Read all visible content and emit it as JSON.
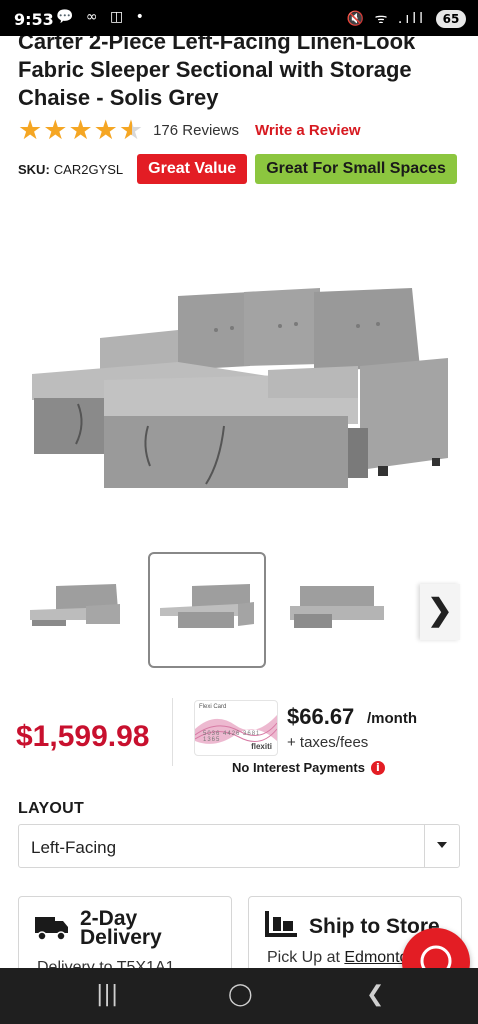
{
  "status_bar": {
    "time": "9:53",
    "left_icons": "💬 ∞ ◫ •",
    "right_icons": "🔇 ᯤ .ıll",
    "battery": "65"
  },
  "product": {
    "title": "Carter 2-Piece Left-Facing Linen-Look Fabric Sleeper Sectional with Storage Chaise - Solis Grey",
    "rating": 4.5,
    "reviews_count_text": "176 Reviews",
    "write_review_label": "Write a Review",
    "sku_label": "SKU:",
    "sku_value": "CAR2GYSL",
    "badges": {
      "great_value": "Great Value",
      "small_spaces": "Great For Small Spaces"
    }
  },
  "gallery": {
    "main_image_icon": "sectional-sofa-image",
    "selected_index": 1,
    "next_arrow": "❯"
  },
  "pricing": {
    "price": "$1,599.98",
    "card": {
      "label": "Flexi Card",
      "number": "5036 4426 3681 1365",
      "brand": "flexiti"
    },
    "monthly_amount": "$66.67",
    "monthly_per": "/month",
    "taxes": "+ taxes/fees",
    "no_interest": "No Interest Payments",
    "info_glyph": "i"
  },
  "layout": {
    "label": "LAYOUT",
    "selected": "Left-Facing"
  },
  "delivery_options": {
    "delivery_title": "2-Day Delivery",
    "delivery_sub": "Delivery to T5X1A1",
    "ship_title": "Ship to Store",
    "ship_sub_prefix": "Pick Up at",
    "ship_sub_link": "Edmonton"
  },
  "nav_bar": {
    "recent": "|||",
    "home": "◯",
    "back": "❮"
  },
  "colors": {
    "brand_red": "#e31d24",
    "price_red": "#c8102e",
    "badge_green": "#8cc63f",
    "star": "#f5a623"
  }
}
